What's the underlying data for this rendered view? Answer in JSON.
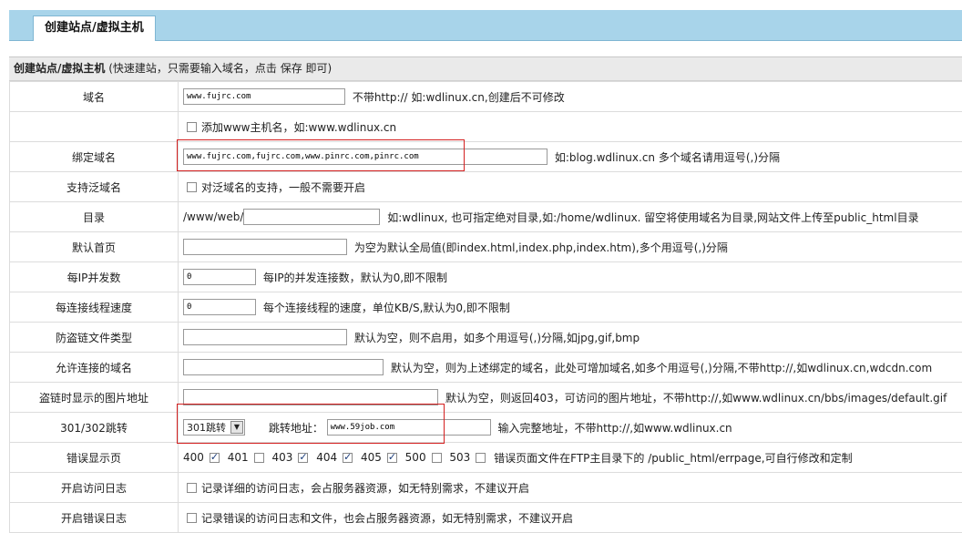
{
  "tab": {
    "label": "创建站点/虚拟主机"
  },
  "panel": {
    "title_bold": "创建站点/虚拟主机",
    "title_note": " (快速建站，只需要输入域名，点击 保存 即可)"
  },
  "rows": {
    "domain": {
      "label": "域名",
      "value": "www.fujrc.com",
      "hint": "不带http:// 如:wdlinux.cn,创建后不可修改"
    },
    "add_www": {
      "label": "添加www主机名，如:www.wdlinux.cn",
      "checked": false
    },
    "bind": {
      "label": "绑定域名",
      "value": "www.fujrc.com,fujrc.com,www.pinrc.com,pinrc.com",
      "hint": "如:blog.wdlinux.cn 多个域名请用逗号(,)分隔"
    },
    "wildcard": {
      "label": "支持泛域名",
      "check_label": "对泛域名的支持，一般不需要开启",
      "checked": false
    },
    "dir": {
      "label": "目录",
      "prefix": "/www/web/",
      "value": "",
      "hint": "如:wdlinux, 也可指定绝对目录,如:/home/wdlinux. 留空将使用域名为目录,网站文件上传至public_html目录"
    },
    "index": {
      "label": "默认首页",
      "value": "",
      "hint": "为空为默认全局值(即index.html,index.php,index.htm),多个用逗号(,)分隔"
    },
    "per_ip": {
      "label": "每IP并发数",
      "value": "0",
      "hint": "每IP的并发连接数，默认为0,即不限制"
    },
    "speed": {
      "label": "每连接线程速度",
      "value": "0",
      "hint": "每个连接线程的速度，单位KB/S,默认为0,即不限制"
    },
    "hotlink_types": {
      "label": "防盗链文件类型",
      "value": "",
      "hint": "默认为空，则不启用，如多个用逗号(,)分隔,如jpg,gif,bmp"
    },
    "allowed_domains": {
      "label": "允许连接的域名",
      "value": "",
      "hint": "默认为空，则为上述绑定的域名，此处可增加域名,如多个用逗号(,)分隔,不带http://,如wdlinux.cn,wdcdn.com"
    },
    "hotlink_image": {
      "label": "盗链时显示的图片地址",
      "value": "",
      "hint": "默认为空，则返回403，可访问的图片地址，不带http://,如www.wdlinux.cn/bbs/images/default.gif"
    },
    "redirect": {
      "label": "301/302跳转",
      "select": "301跳转",
      "target_label": "跳转地址：",
      "value": "www.59job.com",
      "hint": "输入完整地址，不带http://,如www.wdlinux.cn"
    },
    "error_pages": {
      "label": "错误显示页",
      "codes": [
        {
          "code": "400",
          "checked": true
        },
        {
          "code": "401",
          "checked": false
        },
        {
          "code": "403",
          "checked": true
        },
        {
          "code": "404",
          "checked": true
        },
        {
          "code": "405",
          "checked": true
        },
        {
          "code": "500",
          "checked": false
        },
        {
          "code": "503",
          "checked": false
        }
      ],
      "hint": "错误页面文件在FTP主目录下的 /public_html/errpage,可自行修改和定制"
    },
    "access_log": {
      "label": "开启访问日志",
      "check_label": "记录详细的访问日志，会占服务器资源，如无特别需求，不建议开启",
      "checked": false
    },
    "error_log": {
      "label": "开启错误日志",
      "check_label": "记录错误的访问日志和文件，也会占服务器资源，如无特别需求，不建议开启",
      "checked": false
    }
  },
  "colors": {
    "tabbar": "#a8d4ea",
    "highlight": "#d42020",
    "check": "#1a3c7a"
  }
}
